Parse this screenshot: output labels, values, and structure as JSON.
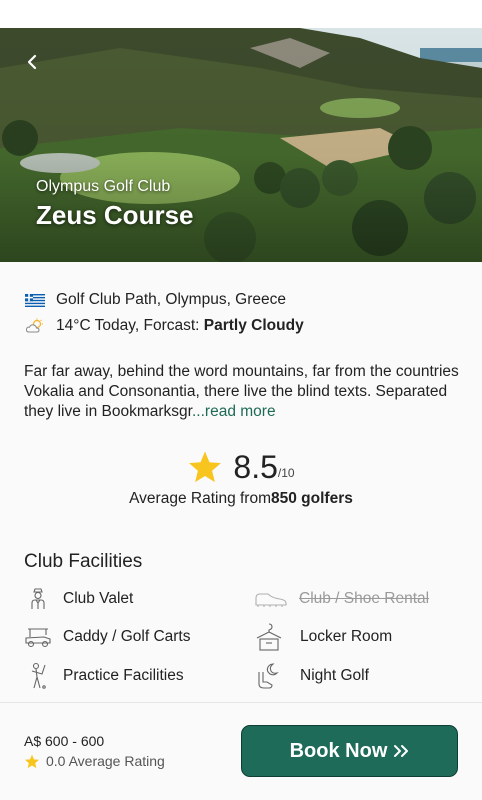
{
  "hero": {
    "club_name": "Olympus Golf Club",
    "course_name": "Zeus Course"
  },
  "location": {
    "address": "Golf Club Path, Olympus, Greece",
    "flag": "greece-flag-icon"
  },
  "weather": {
    "prefix": "14°C Today, Forcast: ",
    "condition": "Partly Cloudy"
  },
  "description": {
    "text": "Far far away, behind the word mountains, far from the countries Vokalia and Consonantia, there live the blind texts. Separated they live in Bookmarksgr",
    "more_link": "...read more"
  },
  "rating": {
    "score": "8.5",
    "max": "/10",
    "caption_prefix": "Average Rating from",
    "caption_count": "850 golfers",
    "star_color": "#f7c51e"
  },
  "facilities": {
    "title": "Club Facilities",
    "items": [
      {
        "label": "Club Valet",
        "icon": "valet-icon",
        "available": true
      },
      {
        "label": "Club / Shoe Rental",
        "icon": "shoe-icon",
        "available": false
      },
      {
        "label": "Caddy / Golf Carts",
        "icon": "golf-cart-icon",
        "available": true
      },
      {
        "label": "Locker Room",
        "icon": "locker-icon",
        "available": true
      },
      {
        "label": "Practice Facilities",
        "icon": "golfer-icon",
        "available": true
      },
      {
        "label": "Night Golf",
        "icon": "night-golf-icon",
        "available": true
      }
    ]
  },
  "footer": {
    "price": "A$ 600 - 600",
    "avg_rating": "0.0 Average Rating",
    "book_label": "Book Now",
    "accent": "#1e6b5a"
  }
}
